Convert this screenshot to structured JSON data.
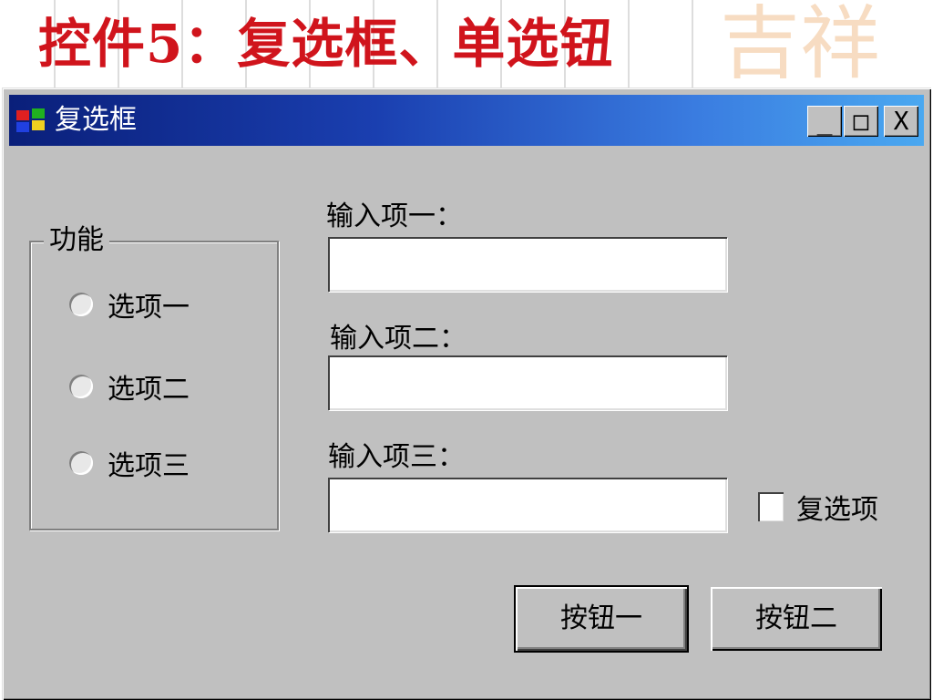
{
  "slide": {
    "title": "控件5：复选框、单选钮",
    "watermark": "吉祥"
  },
  "window": {
    "title": "复选框",
    "controls": {
      "minimize": "_",
      "maximize": "□",
      "close": "X"
    }
  },
  "group": {
    "label": "功能",
    "options": [
      {
        "label": "选项一",
        "selected": false
      },
      {
        "label": "选项二",
        "selected": false
      },
      {
        "label": "选项三",
        "selected": false
      }
    ]
  },
  "fields": [
    {
      "label": "输入项一：",
      "value": ""
    },
    {
      "label": "输入项二：",
      "value": ""
    },
    {
      "label": "输入项三：",
      "value": ""
    }
  ],
  "checkbox": {
    "label": "复选项",
    "checked": false
  },
  "buttons": {
    "button1": "按钮一",
    "button2": "按钮二"
  },
  "colors": {
    "title_red": "#d0141c",
    "dialog_gray": "#c0c0c0",
    "titlebar_start": "#0a1f7a",
    "titlebar_end": "#4aa8f0"
  }
}
